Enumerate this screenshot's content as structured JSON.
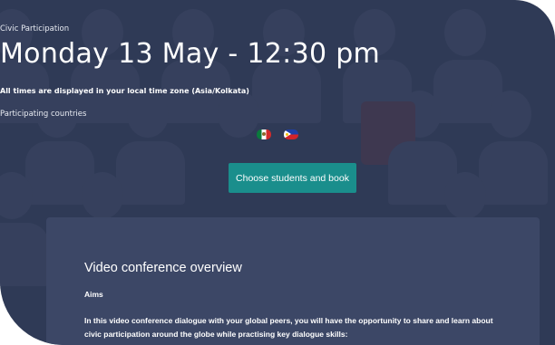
{
  "header": {
    "category": "Civic Participation",
    "title": "Monday 13 May - 12:30 pm",
    "timezone_note": "All times are displayed in your local time zone (Asia/Kolkata)",
    "participating_label": "Participating countries",
    "flags": [
      "mexico-flag-icon",
      "philippines-flag-icon"
    ]
  },
  "cta": {
    "label": "Choose students and book",
    "color": "#1a8e8c"
  },
  "overview": {
    "title": "Video conference overview",
    "aims_heading": "Aims",
    "intro": "In this video conference dialogue with your global peers, you will have the opportunity to share and learn about civic participation around the globe while practising key dialogue skills:"
  },
  "colors": {
    "background": "#2f3a56",
    "panel": "#3c4766"
  }
}
